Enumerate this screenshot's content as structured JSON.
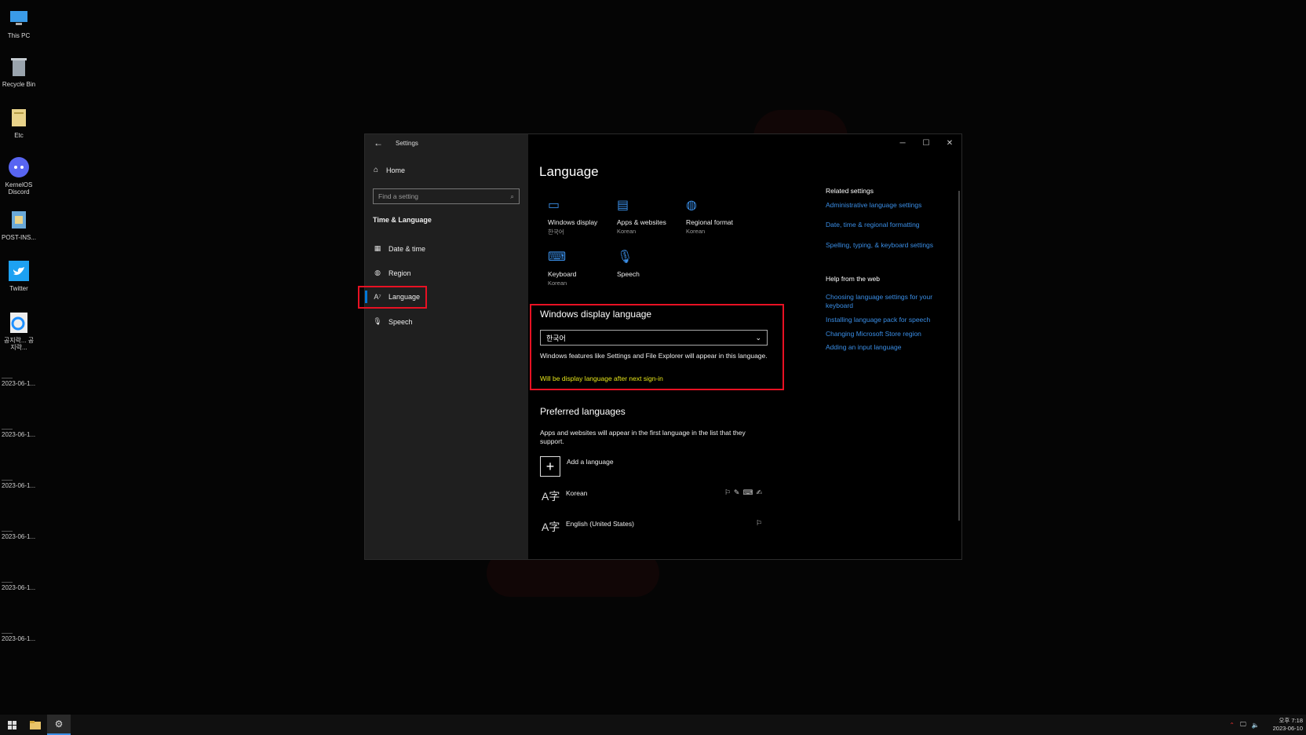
{
  "desktop": {
    "icons": [
      {
        "label": "This PC",
        "icon": "computer-icon"
      },
      {
        "label": "Recycle Bin",
        "icon": "recycle-bin-icon"
      },
      {
        "label": "Etc",
        "icon": "folder-icon"
      },
      {
        "label": "KernelOS Discord",
        "icon": "discord-icon"
      },
      {
        "label": "POST-INS...",
        "icon": "installer-icon"
      },
      {
        "label": "Twitter",
        "icon": "twitter-icon"
      },
      {
        "label": "공지락... 공지락...",
        "icon": "internet-explorer-icon"
      }
    ],
    "files": [
      "2023-06-1...",
      "2023-06-1...",
      "2023-06-1...",
      "2023-06-1...",
      "2023-06-1...",
      "2023-06-1..."
    ]
  },
  "window": {
    "title": "Settings",
    "controls": {
      "minimize": "─",
      "maximize": "☐",
      "close": "✕"
    }
  },
  "sidebar": {
    "home_label": "Home",
    "search_placeholder": "Find a setting",
    "section_title": "Time & Language",
    "items": [
      {
        "label": "Date & time",
        "icon": "calendar-clock-icon"
      },
      {
        "label": "Region",
        "icon": "globe-icon"
      },
      {
        "label": "Language",
        "icon": "language-icon"
      },
      {
        "label": "Speech",
        "icon": "microphone-icon"
      }
    ],
    "selected": "Language"
  },
  "main": {
    "title": "Language",
    "tiles": [
      {
        "label": "Windows display",
        "sub": "한국어",
        "icon": "laptop-icon"
      },
      {
        "label": "Apps & websites",
        "sub": "Korean",
        "icon": "window-icon"
      },
      {
        "label": "Regional format",
        "sub": "Korean",
        "icon": "globe-icon"
      },
      {
        "label": "Keyboard",
        "sub": "Korean",
        "icon": "keyboard-icon"
      },
      {
        "label": "Speech",
        "sub": "",
        "icon": "microphone-icon"
      }
    ],
    "display_language": {
      "heading": "Windows display language",
      "selected": "한국어",
      "description": "Windows features like Settings and File Explorer will appear in this language.",
      "notice": "Will be display language after next sign-in"
    },
    "preferred": {
      "heading": "Preferred languages",
      "description": "Apps and websites will appear in the first language in the list that they support.",
      "add_label": "Add a language",
      "languages": [
        {
          "name": "Korean",
          "features": "⚐✎⌨✍"
        },
        {
          "name": "English (United States)",
          "features": "⚐"
        }
      ]
    },
    "related": {
      "heading": "Related settings",
      "links": [
        "Administrative language settings",
        "Date, time & regional formatting",
        "Spelling, typing, & keyboard settings"
      ]
    },
    "help": {
      "heading": "Help from the web",
      "links": [
        "Choosing language settings for your keyboard",
        "Installing language pack for speech",
        "Changing Microsoft Store region",
        "Adding an input language"
      ]
    }
  },
  "taskbar": {
    "time": "오후 7:18",
    "date": "2023-06-10"
  },
  "colors": {
    "accent": "#3a8ee6",
    "highlight": "#e81123",
    "warning": "#e5e51a"
  }
}
